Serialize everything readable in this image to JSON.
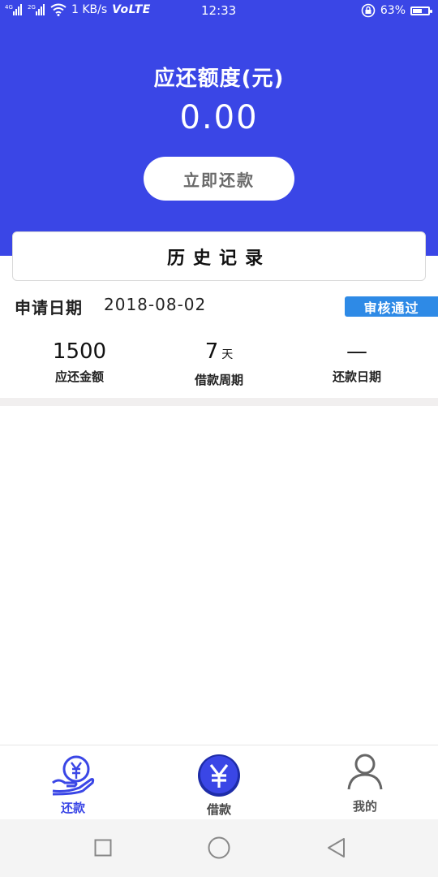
{
  "status_bar": {
    "net_4g": "4G",
    "net_2g": "2G",
    "speed": "1 KB/s",
    "volte": "VoLTE",
    "time": "12:33",
    "battery_pct": "63%",
    "battery_level": 0.63
  },
  "summary": {
    "title": "应还额度(元)",
    "amount": "0.00",
    "repay_button": "立即还款"
  },
  "history": {
    "title": "历史记录"
  },
  "record": {
    "apply_label": "申请日期",
    "apply_date": "2018-08-02",
    "status": "审核通过",
    "stats": [
      {
        "value": "1500",
        "unit": "",
        "label": "应还金额"
      },
      {
        "value": "7",
        "unit": "天",
        "label": "借款周期"
      },
      {
        "value": "—",
        "unit": "",
        "label": "还款日期"
      }
    ]
  },
  "tabs": [
    {
      "label": "还款",
      "icon": "repay-hand-yen-icon",
      "active": true
    },
    {
      "label": "借款",
      "icon": "yen-coin-icon",
      "active": false
    },
    {
      "label": "我的",
      "icon": "user-profile-icon",
      "active": false
    }
  ],
  "colors": {
    "primary": "#3a46e6",
    "badge": "#2e8ae6",
    "active_tab": "#3a46e6",
    "inactive_tab": "#666666"
  }
}
